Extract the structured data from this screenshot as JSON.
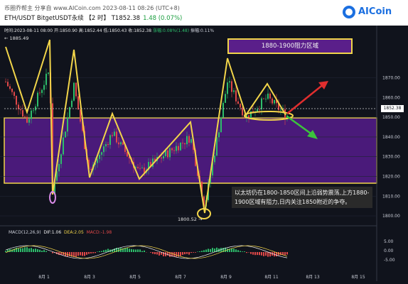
{
  "header": {
    "line1": "币圈乔帮主   分享自 www.AICoin.com    2023-08-11 08:26 (UTC+8)",
    "title": "ETH/USDT BitgetUSDT永续 【2 时】 T1852.38",
    "change": "1.48 (0.07%)",
    "logo_text": "AICoin"
  },
  "info_bar": {
    "prefix": "时间:2023-08-11 08:00  开:1850.90  高:1852.44  低:1850.43  收:1852.38  ",
    "change": "涨幅:0.08%(1.48)",
    "amp": "  振幅:0.11%"
  },
  "high_marker": "1885.49",
  "low_marker": "1800.52",
  "resistance_label": "1880-1900阻力区域",
  "current_price": "1852.38",
  "note": "以太坊仍在1800-1850区间上沿弱势震荡,上方1880-1900区域有阻力,日内关注1850附近的争夺。",
  "macd": {
    "label": "MACD(12,26,9)",
    "dif": "DIF:1.06",
    "dea": "DEA:2.05",
    "macd": "MACD:-1.98"
  },
  "colors": {
    "bg": "#10131c",
    "up": "#2dbd6b",
    "down": "#e04848",
    "zone": "#4a1a7a",
    "yellow": "#f2d54a"
  },
  "chart_data": {
    "type": "candlestick",
    "y_ticks": [
      "1870.00",
      "1860.00",
      "1850.00",
      "1840.00",
      "1830.00",
      "1820.00",
      "1810.00",
      "1800.00"
    ],
    "y_tick_values": [
      1870,
      1860,
      1850,
      1840,
      1830,
      1820,
      1810,
      1800
    ],
    "macd_ticks": [
      "5.00",
      "0.00",
      "-5.00"
    ],
    "x_ticks": [
      "8月 1",
      "8月 3",
      "8月 5",
      "8月 7",
      "8月 9",
      "8月 11",
      "8月 13",
      "8月 15"
    ],
    "ylim": [
      1795,
      1890
    ]
  }
}
